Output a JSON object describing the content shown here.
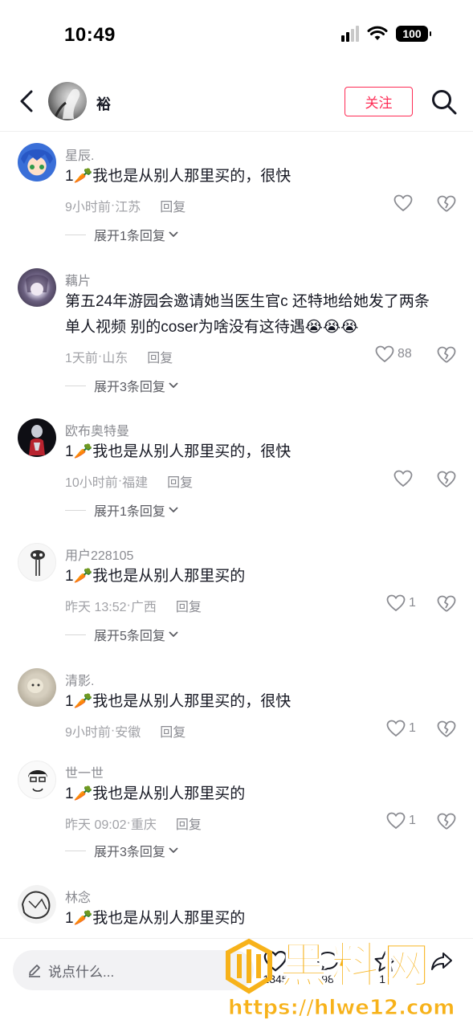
{
  "status_bar": {
    "time": "10:49",
    "battery": "100"
  },
  "header": {
    "author_name": "裕",
    "follow_label": "关注"
  },
  "comments": [
    {
      "username": "星辰.",
      "text": "1🥕我也是从别人那里买的，很快",
      "time": "9小时前",
      "location": "江苏",
      "reply_label": "回复",
      "likes": "",
      "expand": "展开1条回复"
    },
    {
      "username": "藕片",
      "text_line1": "第五24年游园会邀请她当医生官c 还特地给她发了两条",
      "text_line2": "单人视频 别的coser为啥没有这待遇😭😭😭",
      "time": "1天前",
      "location": "山东",
      "reply_label": "回复",
      "likes": "88",
      "expand": "展开3条回复"
    },
    {
      "username": "欧布奥特曼",
      "text": "1🥕我也是从别人那里买的，很快",
      "time": "10小时前",
      "location": "福建",
      "reply_label": "回复",
      "likes": "",
      "expand": "展开1条回复"
    },
    {
      "username": "用户228105",
      "text": "1🥕我也是从别人那里买的",
      "time": "昨天 13:52",
      "location": "广西",
      "reply_label": "回复",
      "likes": "1",
      "expand": "展开5条回复"
    },
    {
      "username": "清影.",
      "text": "1🥕我也是从别人那里买的，很快",
      "time": "9小时前",
      "location": "安徽",
      "reply_label": "回复",
      "likes": "1",
      "expand": ""
    },
    {
      "username": "世一世",
      "text": "1🥕我也是从别人那里买的",
      "time": "昨天 09:02",
      "location": "重庆",
      "reply_label": "回复",
      "likes": "1",
      "expand": "展开3条回复"
    },
    {
      "username": "林念",
      "text": "1🥕我也是从别人那里买的"
    }
  ],
  "meta_separator": " · ",
  "bottom_bar": {
    "input_placeholder": "说点什么...",
    "like_count": "1345",
    "comment_count": "98",
    "star_count": "18"
  },
  "watermark": {
    "title": "黑料网",
    "url": "https://hlwe12.com"
  },
  "colors": {
    "accent": "#fe2c55",
    "watermark": "#f7b21a",
    "meta": "#a1a2a7"
  },
  "icons": [
    "back-arrow-icon",
    "search-icon",
    "heart-icon",
    "broken-heart-icon",
    "chevron-down-icon",
    "pencil-icon",
    "star-icon",
    "share-icon"
  ]
}
